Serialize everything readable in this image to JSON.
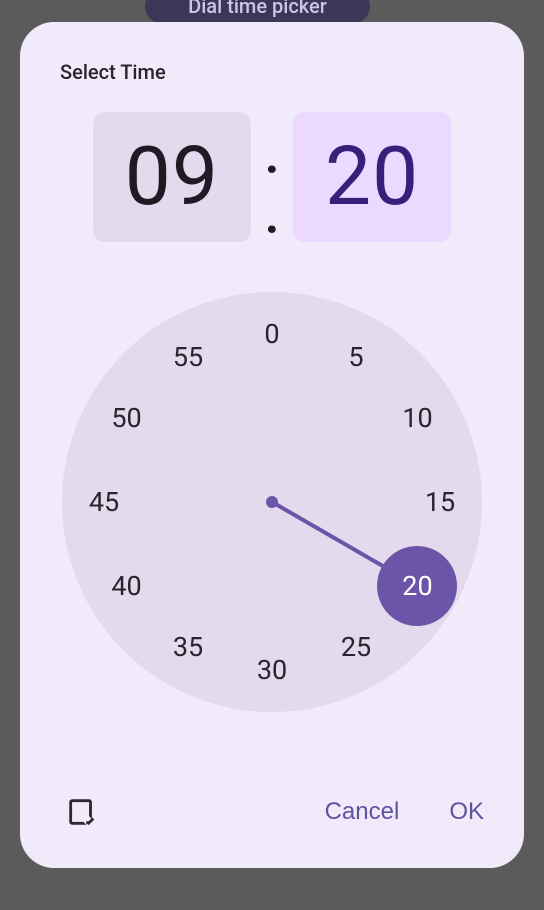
{
  "backdrop": {
    "chip_label": "Dial time picker"
  },
  "dialog": {
    "title": "Select Time",
    "hour": "09",
    "minute": "20",
    "active_field": "minute",
    "clock": {
      "labels": [
        "0",
        "5",
        "10",
        "15",
        "20",
        "25",
        "30",
        "35",
        "40",
        "45",
        "50",
        "55"
      ],
      "selected_index": 4,
      "selected_value": "20"
    },
    "footer": {
      "keyboard_icon": "keyboard-input-icon",
      "cancel_label": "Cancel",
      "ok_label": "OK"
    }
  },
  "colors": {
    "accent": "#6c55a8",
    "surface": "#f1eafb",
    "tonal": "#e3daed",
    "active_bg": "#ebd9ff",
    "active_fg": "#3a1f7a"
  }
}
